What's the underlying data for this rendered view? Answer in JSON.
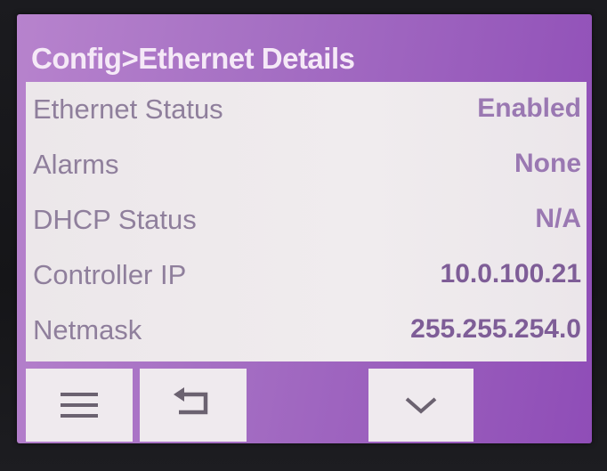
{
  "screen": {
    "title": "Config>Ethernet Details"
  },
  "details": [
    {
      "label": "Ethernet Status",
      "value": "Enabled"
    },
    {
      "label": "Alarms",
      "value": "None"
    },
    {
      "label": "DHCP Status",
      "value": "N/A"
    },
    {
      "label": "Controller IP",
      "value": "10.0.100.21"
    },
    {
      "label": "Netmask",
      "value": "255.255.254.0"
    }
  ],
  "buttons": {
    "menu_icon": "hamburger-menu-icon",
    "back_icon": "return-arrow-icon",
    "down_icon": "chevron-down-icon"
  },
  "colors": {
    "title_bar": "#b783cd",
    "panel_bg": "#ece7ea",
    "label_text": "#8f7f9c",
    "value_text": "#9a78b2"
  }
}
